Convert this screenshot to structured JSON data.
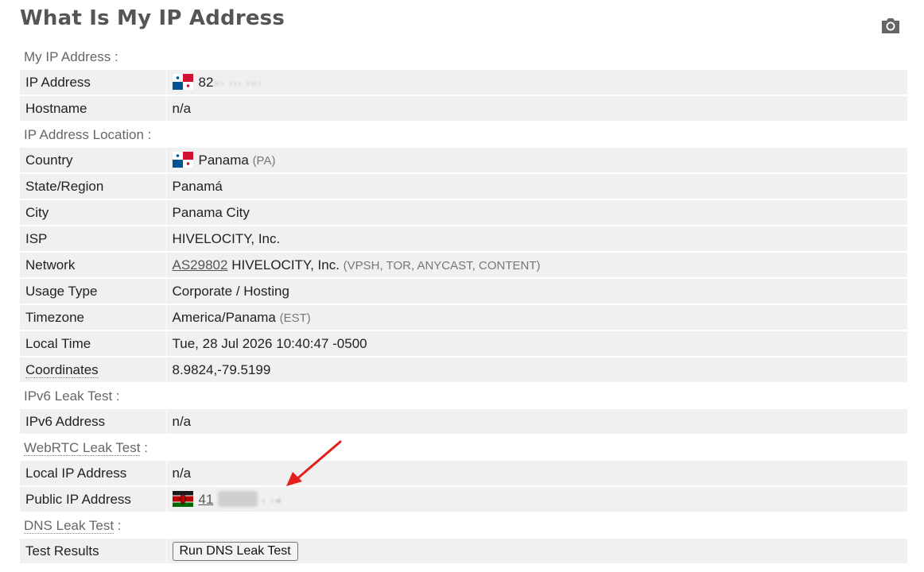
{
  "page": {
    "title": "What Is My IP Address"
  },
  "icons": {
    "camera": "camera-icon",
    "flag_panama": "panama-flag-icon",
    "flag_kenya": "kenya-flag-icon"
  },
  "colors": {
    "annotation_arrow": "#e3201b",
    "row_background": "#f0f0f0"
  },
  "sections": {
    "my_ip": "My IP Address :",
    "location": "IP Address Location :",
    "ipv6": "IPv6 Leak Test :",
    "webrtc_label": "WebRTC Leak Test",
    "webrtc_colon": " :",
    "dns_label": "DNS Leak Test",
    "dns_colon": " :"
  },
  "rows": {
    "ip_address": {
      "label": "IP Address",
      "value": "82",
      "blurred": "»› ›››  ›«‹"
    },
    "hostname": {
      "label": "Hostname",
      "value": "n/a"
    },
    "country": {
      "label": "Country",
      "value": "Panama",
      "code": "(PA)"
    },
    "state": {
      "label": "State/Region",
      "value": "Panamá"
    },
    "city": {
      "label": "City",
      "value": "Panama City"
    },
    "isp": {
      "label": "ISP",
      "value": "HIVELOCITY, Inc."
    },
    "network": {
      "label": "Network",
      "asn": "AS29802",
      "value": "HIVELOCITY, Inc.",
      "tags": "(VPSH, TOR, ANYCAST, CONTENT)"
    },
    "usage_type": {
      "label": "Usage Type",
      "value": "Corporate / Hosting"
    },
    "timezone": {
      "label": "Timezone",
      "value": "America/Panama",
      "abbr": "(EST)"
    },
    "local_time": {
      "label": "Local Time",
      "value": "Tue, 28 Jul 2026 10:40:47 -0500"
    },
    "coordinates": {
      "label": "Coordinates",
      "value": "8.9824,-79.5199"
    },
    "ipv6_address": {
      "label": "IPv6 Address",
      "value": "n/a"
    },
    "local_ip": {
      "label": "Local IP Address",
      "value": "n/a"
    },
    "public_ip": {
      "label": "Public IP Address",
      "value": "41",
      "blurred": "‹ ›◂"
    },
    "test_results": {
      "label": "Test Results",
      "button": "Run DNS Leak Test"
    }
  }
}
